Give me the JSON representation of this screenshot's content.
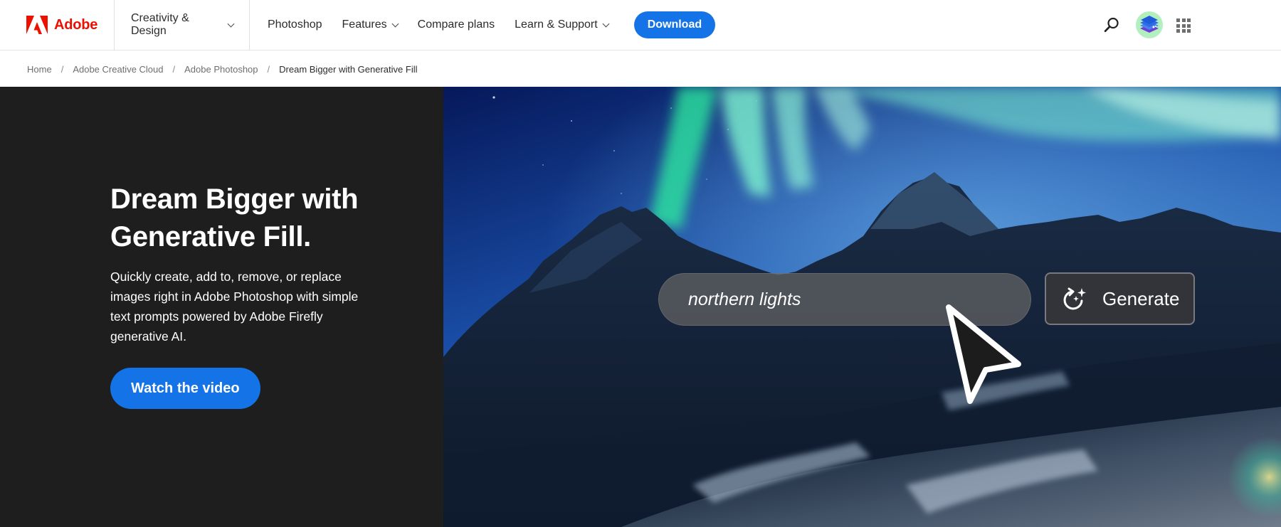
{
  "header": {
    "logo_text": "Adobe",
    "nav_primary": {
      "label": "Creativity & Design"
    },
    "nav_items": [
      {
        "label": "Photoshop",
        "has_dropdown": false
      },
      {
        "label": "Features",
        "has_dropdown": true
      },
      {
        "label": "Compare plans",
        "has_dropdown": false
      },
      {
        "label": "Learn & Support",
        "has_dropdown": true
      }
    ],
    "download_label": "Download",
    "icons": [
      "search-icon",
      "avatar",
      "apps-grid-icon"
    ],
    "brand_color": "#eb1000",
    "accent_color": "#1473e6"
  },
  "breadcrumb": {
    "items": [
      "Home",
      "Adobe Creative Cloud",
      "Adobe Photoshop"
    ],
    "current": "Dream Bigger with Generative Fill",
    "separator": "/"
  },
  "hero": {
    "title_line1": "Dream Bigger with",
    "title_line2": "Generative Fill.",
    "description": "Quickly create, add to, remove, or replace images right in Adobe Photoshop with simple text prompts powered by Adobe Firefly generative AI.",
    "cta_label": "Watch the video",
    "image": {
      "subject": "northern lights over mountains",
      "prompt_text": "northern lights",
      "generate_label": "Generate"
    }
  }
}
